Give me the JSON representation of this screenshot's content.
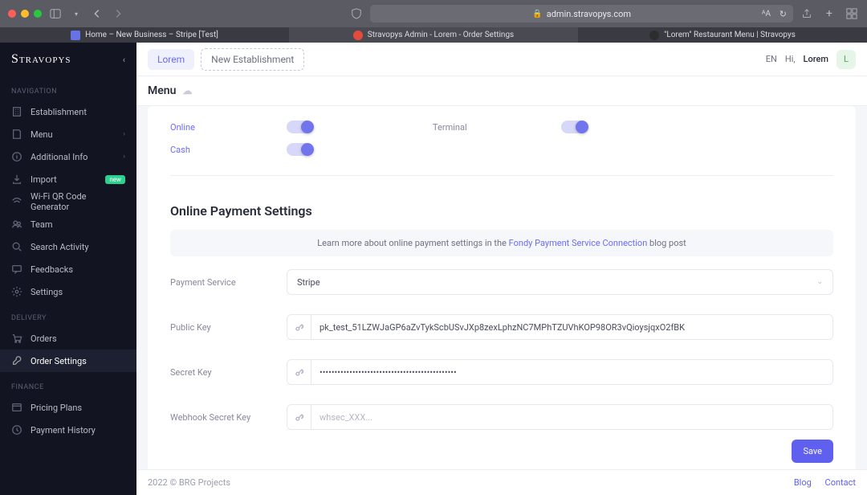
{
  "browser": {
    "url": "admin.stravopys.com",
    "tabs": [
      {
        "label": "Home – New Business – Stripe [Test]",
        "fav": "#6772e5"
      },
      {
        "label": "Stravopys Admin - Lorem - Order Settings",
        "fav": "#e34b3d"
      },
      {
        "label": "\"Lorem\" Restaurant Menu | Stravopys",
        "fav": "#efefef"
      }
    ]
  },
  "logo": "Stravopys",
  "sidebar": {
    "sections": [
      {
        "label": "NAVIGATION",
        "items": [
          {
            "label": "Establishment",
            "icon": "building"
          },
          {
            "label": "Menu",
            "icon": "menu",
            "chev": true
          },
          {
            "label": "Additional Info",
            "icon": "info",
            "chev": true
          },
          {
            "label": "Import",
            "icon": "import",
            "badge": "new"
          },
          {
            "label": "Wi-Fi QR Code Generator",
            "icon": "wifi"
          },
          {
            "label": "Team",
            "icon": "team"
          },
          {
            "label": "Search Activity",
            "icon": "search"
          },
          {
            "label": "Feedbacks",
            "icon": "feedback"
          },
          {
            "label": "Settings",
            "icon": "settings"
          }
        ]
      },
      {
        "label": "DELIVERY",
        "items": [
          {
            "label": "Orders",
            "icon": "cart"
          },
          {
            "label": "Order Settings",
            "icon": "wrench",
            "active": true
          }
        ]
      },
      {
        "label": "FINANCE",
        "items": [
          {
            "label": "Pricing Plans",
            "icon": "plans"
          },
          {
            "label": "Payment History",
            "icon": "history"
          }
        ]
      }
    ]
  },
  "header": {
    "tab_active": "Lorem",
    "tab_new": "New Establishment",
    "lang": "EN",
    "greet": "Hi,",
    "user": "Lorem",
    "avatar": "L"
  },
  "page": {
    "title": "Menu",
    "toggles": {
      "online": "Online",
      "terminal": "Terminal",
      "cash": "Cash"
    },
    "sect_title": "Online Payment Settings",
    "info_pre": "Learn more about online payment settings in the ",
    "info_link": "Fondy Payment Service Connection",
    "info_post": " blog post",
    "fields": {
      "service_label": "Payment Service",
      "service_value": "Stripe",
      "pk_label": "Public Key",
      "pk_value": "pk_test_51LZWJaGP6aZvTykScbUSvJXp8zexLphzNC7MPhTZUVhKOP98OR3vQioysjqxO2fBK",
      "sk_label": "Secret Key",
      "sk_value": "••••••••••••••••••••••••••••••••••••••••••••••",
      "wh_label": "Webhook Secret Key",
      "wh_placeholder": "whsec_XXX..."
    },
    "save": "Save"
  },
  "footer": {
    "copy": "2022 © BRG Projects",
    "blog": "Blog",
    "contact": "Contact"
  }
}
